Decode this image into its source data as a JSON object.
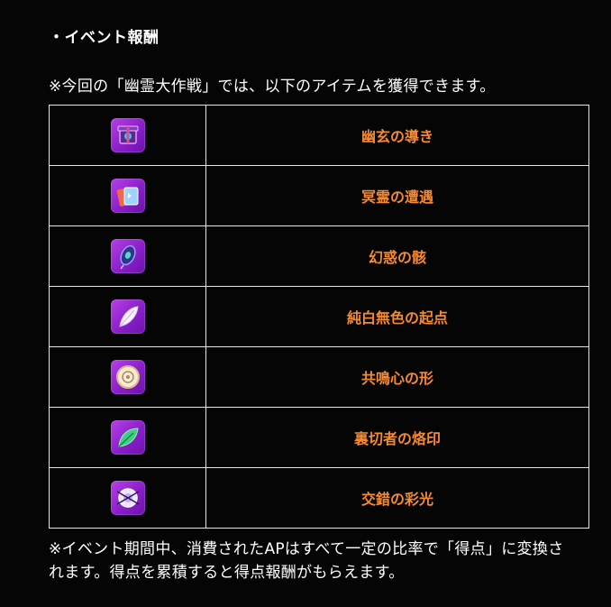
{
  "section_heading": "・イベント報酬",
  "intro_text": "※今回の「幽霊大作戦」では、以下のアイテムを獲得できます。",
  "rewards": [
    {
      "name": "幽玄の導き",
      "icon": "purple-gift-box-icon"
    },
    {
      "name": "冥霊の遭遇",
      "icon": "card-pack-icon"
    },
    {
      "name": "幻惑の骸",
      "icon": "peacock-feather-icon"
    },
    {
      "name": "純白無色の起点",
      "icon": "white-feather-icon"
    },
    {
      "name": "共鳴心の形",
      "icon": "round-badge-icon"
    },
    {
      "name": "裏切者の烙印",
      "icon": "green-leaf-icon"
    },
    {
      "name": "交錯の彩光",
      "icon": "glowing-orb-icon"
    }
  ],
  "note_text": "※イベント期間中、消費されたAPはすべて一定の比率で「得点」に変換されます。得点を累積すると得点報酬がもらえます。",
  "colors": {
    "background": "#050505",
    "item_name": "#f58a33",
    "border": "#e6e6e6",
    "icon_bg": "#a12fd8"
  }
}
